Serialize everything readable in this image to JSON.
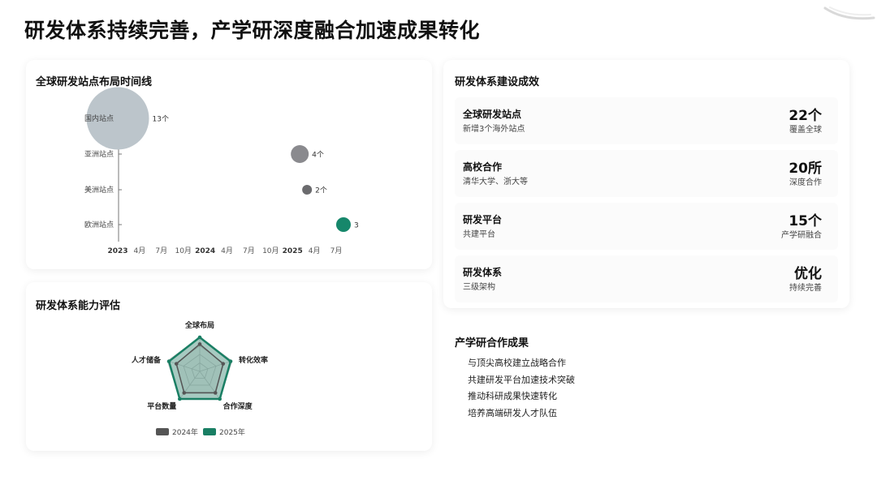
{
  "page": {
    "title": "研发体系持续完善，产学研深度融合加速成果转化"
  },
  "timeline_card": {
    "title": "全球研发站点布局时间线"
  },
  "radar_card": {
    "title": "研发体系能力评估"
  },
  "results_card": {
    "title": "研发体系建设成效",
    "items": [
      {
        "label": "全球研发站点",
        "sub": "新增3个海外站点",
        "value": "22个",
        "note": "覆盖全球"
      },
      {
        "label": "高校合作",
        "sub": "清华大学、浙大等",
        "value": "20所",
        "note": "深度合作"
      },
      {
        "label": "研发平台",
        "sub": "共建平台",
        "value": "15个",
        "note": "产学研融合"
      },
      {
        "label": "研发体系",
        "sub": "三级架构",
        "value": "优化",
        "note": "持续完善"
      }
    ]
  },
  "collab_card": {
    "title": "产学研合作成果",
    "items": [
      "与顶尖高校建立战略合作",
      "共建研发平台加速技术突破",
      "推动科研成果快速转化",
      "培养高端研发人才队伍"
    ]
  },
  "chart_data": [
    {
      "type": "scatter",
      "title": "全球研发站点布局时间线",
      "x_ticks": [
        "2023",
        "4月",
        "7月",
        "10月",
        "2024",
        "4月",
        "7月",
        "10月",
        "2025",
        "4月",
        "7月"
      ],
      "x_range": [
        "2023-01",
        "2025-09"
      ],
      "categories": [
        "国内站点",
        "亚洲站点",
        "美洲站点",
        "欧洲站点"
      ],
      "points": [
        {
          "category": "国内站点",
          "date": "2023-01",
          "value": 13,
          "label": "13个",
          "color": "#bcc5cb"
        },
        {
          "category": "亚洲站点",
          "date": "2025-02",
          "value": 4,
          "label": "4个",
          "color": "#8a8a8e"
        },
        {
          "category": "美洲站点",
          "date": "2025-03",
          "value": 2,
          "label": "2个",
          "color": "#6b6b6e"
        },
        {
          "category": "欧洲站点",
          "date": "2025-08",
          "value": 3,
          "label": "3",
          "color": "#16876b"
        }
      ],
      "grid": false,
      "legend": "none"
    },
    {
      "type": "radar",
      "title": "研发体系能力评估",
      "axes": [
        "全球布局",
        "转化效率",
        "合作深度",
        "平台数量",
        "人才储备"
      ],
      "series": [
        {
          "name": "2024年",
          "values": [
            0.8,
            0.72,
            0.78,
            0.78,
            0.72
          ],
          "color": "#555555"
        },
        {
          "name": "2025年",
          "values": [
            1.0,
            0.95,
            1.0,
            1.0,
            0.95
          ],
          "color": "#1a7f64"
        }
      ],
      "legend": "bottom"
    }
  ]
}
